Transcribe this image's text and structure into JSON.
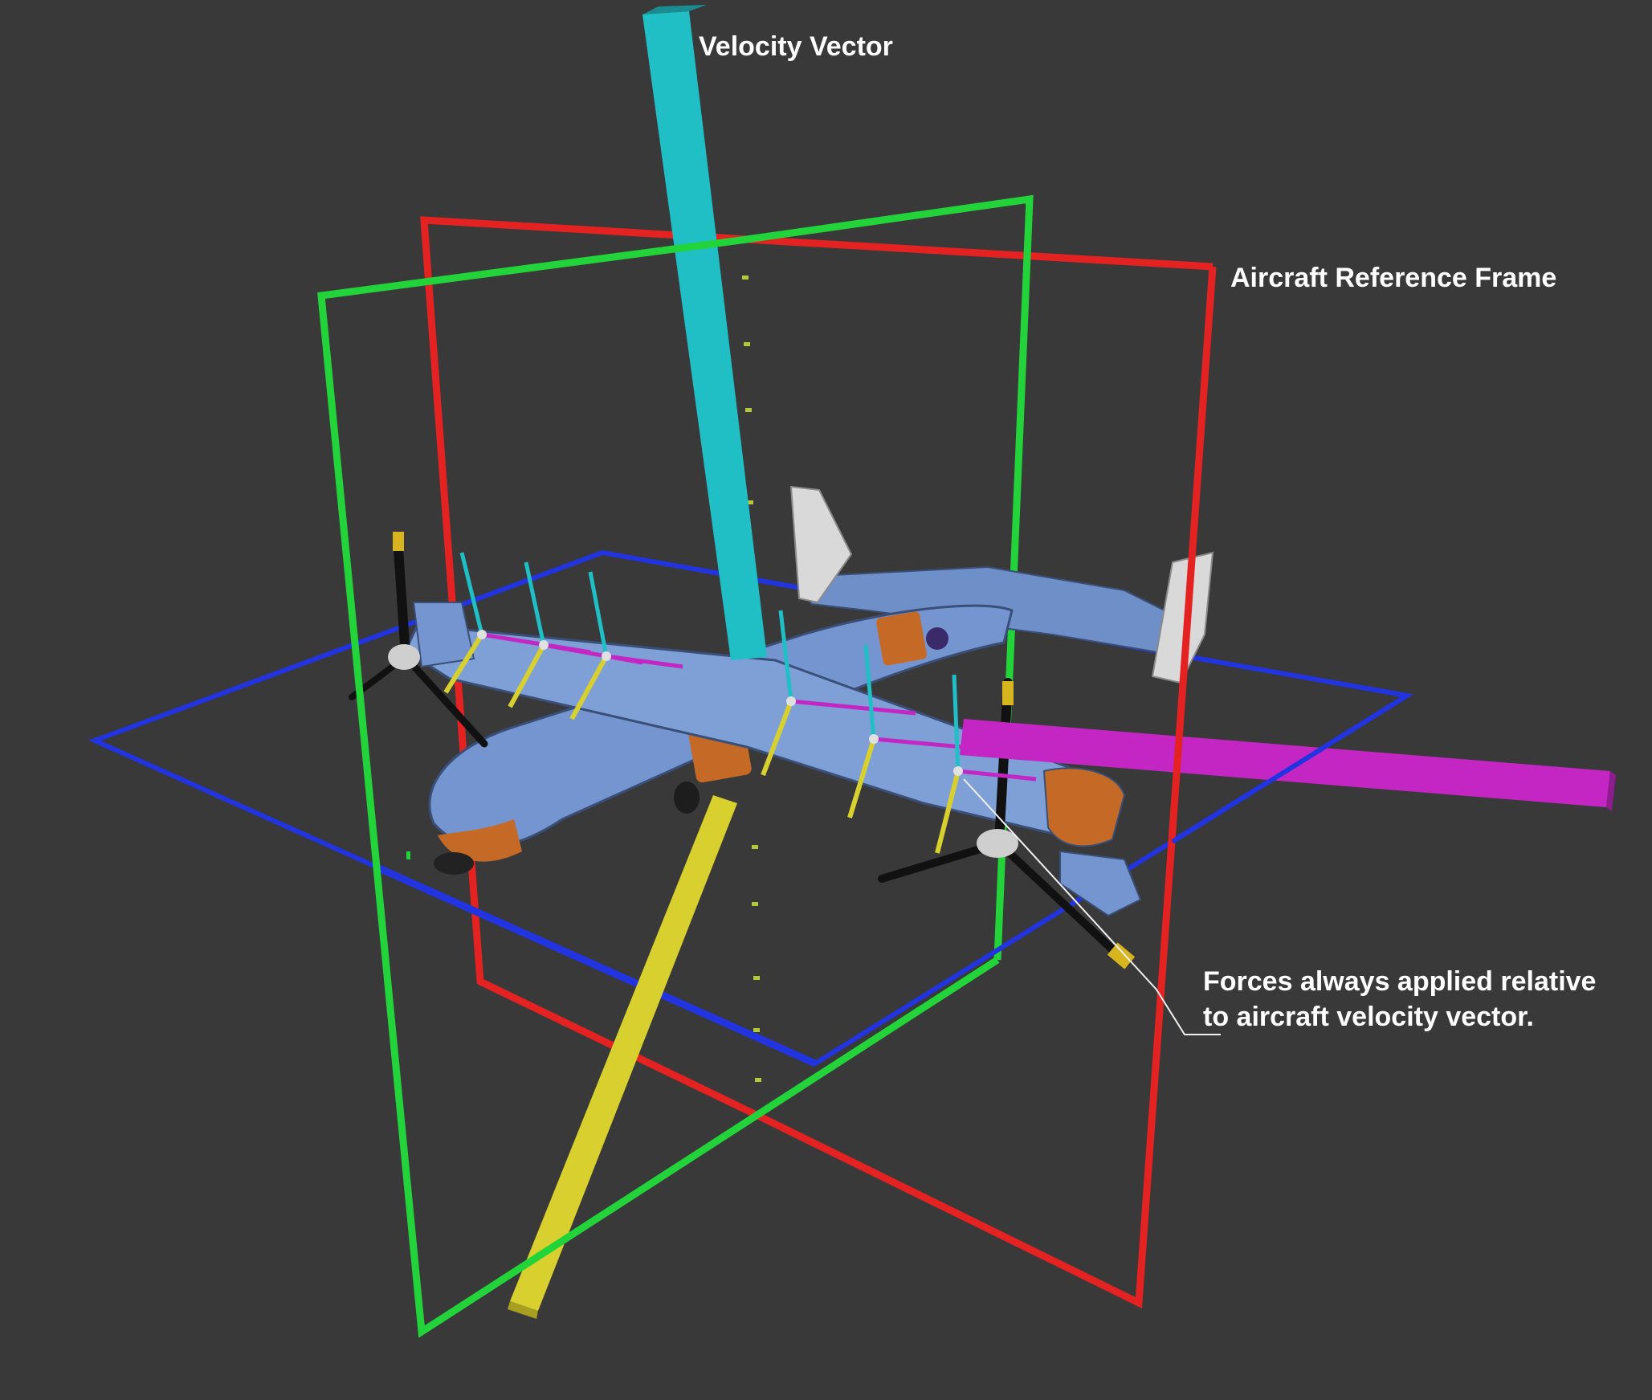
{
  "labels": {
    "velocity_vector": "Velocity Vector",
    "reference_frame": "Aircraft Reference Frame",
    "forces_line1": "Forces always applied relative",
    "forces_line2": "to aircraft velocity vector."
  },
  "colors": {
    "background": "#393939",
    "frame_x_plane": "#e52222",
    "frame_y_plane": "#22d43a",
    "frame_z_plane": "#2233e0",
    "velocity_vector": "#20bfc6",
    "lateral_force": "#c426c4",
    "lift_force": "#d8d02e",
    "aircraft_body": "#6f8fc8",
    "aircraft_accent": "#c46a26",
    "annotation_text": "#ffffff"
  }
}
